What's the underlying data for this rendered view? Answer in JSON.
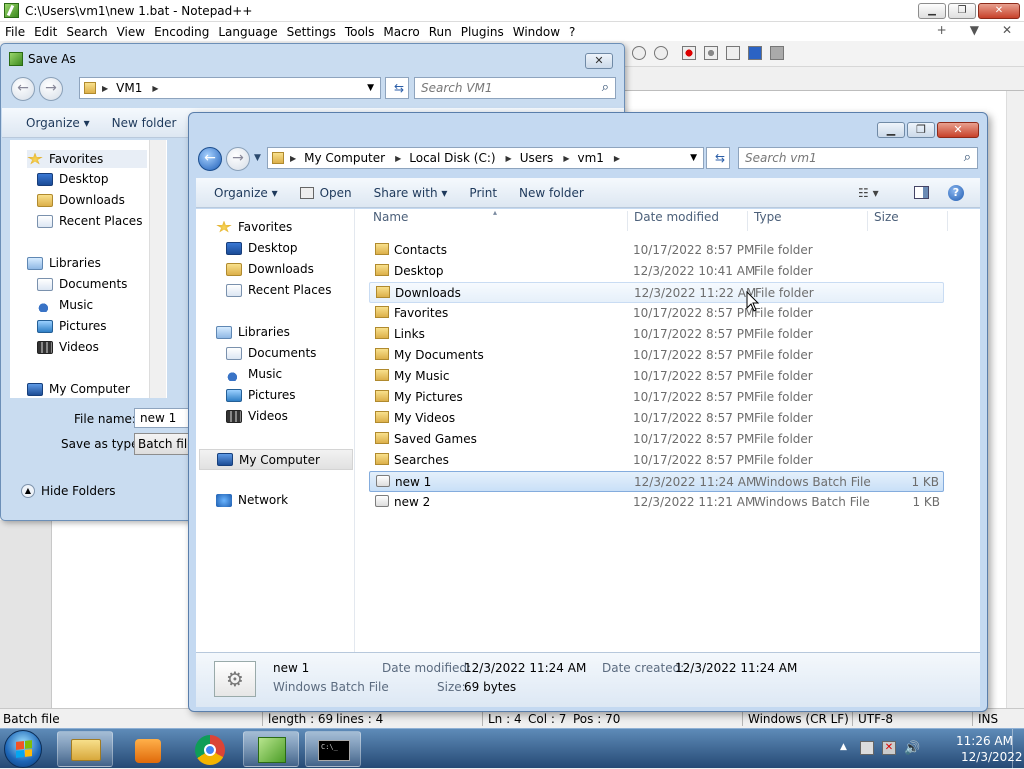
{
  "npp": {
    "title": "C:\\Users\\vm1\\new 1.bat - Notepad++",
    "menu": [
      "File",
      "Edit",
      "Search",
      "View",
      "Encoding",
      "Language",
      "Settings",
      "Tools",
      "Macro",
      "Run",
      "Plugins",
      "Window",
      "?"
    ],
    "menu_right": [
      "+",
      "▼",
      "✕"
    ],
    "window_buttons": {
      "min": "▁",
      "max": "❐",
      "close": "✕"
    },
    "status": {
      "type": "Batch file",
      "length": "length : 69",
      "lines": "lines : 4",
      "ln": "Ln : 4",
      "col": "Col : 7",
      "pos": "Pos : 70",
      "eol": "Windows (CR LF)",
      "encoding": "UTF-8",
      "mode": "INS"
    }
  },
  "saveas": {
    "title": "Save As",
    "close": "✕",
    "address": [
      "VM1"
    ],
    "search_placeholder": "Search VM1",
    "toolbar": {
      "organize": "Organize ▾",
      "new_folder": "New folder"
    },
    "nav": {
      "favorites": "Favorites",
      "desktop": "Desktop",
      "downloads": "Downloads",
      "recent": "Recent Places",
      "libraries": "Libraries",
      "documents": "Documents",
      "music": "Music",
      "pictures": "Pictures",
      "videos": "Videos",
      "computer": "My Computer"
    },
    "file_name_label": "File name:",
    "file_name_value": "new 1",
    "save_type_label": "Save as type:",
    "save_type_value": "Batch file",
    "hide_folders": "Hide Folders"
  },
  "explorer": {
    "address": [
      "My Computer",
      "Local Disk (C:)",
      "Users",
      "vm1"
    ],
    "search_placeholder": "Search vm1",
    "toolbar": {
      "organize": "Organize ▾",
      "open": "Open",
      "share": "Share with ▾",
      "print": "Print",
      "new_folder": "New folder"
    },
    "nav": {
      "favorites": "Favorites",
      "desktop": "Desktop",
      "downloads": "Downloads",
      "recent": "Recent Places",
      "libraries": "Libraries",
      "documents": "Documents",
      "music": "Music",
      "pictures": "Pictures",
      "videos": "Videos",
      "computer": "My Computer",
      "network": "Network"
    },
    "columns": {
      "name": "Name",
      "date": "Date modified",
      "type": "Type",
      "size": "Size"
    },
    "files": [
      {
        "name": "Contacts",
        "date": "10/17/2022 8:57 PM",
        "type": "File folder",
        "size": ""
      },
      {
        "name": "Desktop",
        "date": "12/3/2022 10:41 AM",
        "type": "File folder",
        "size": ""
      },
      {
        "name": "Downloads",
        "date": "12/3/2022 11:22 AM",
        "type": "File folder",
        "size": ""
      },
      {
        "name": "Favorites",
        "date": "10/17/2022 8:57 PM",
        "type": "File folder",
        "size": ""
      },
      {
        "name": "Links",
        "date": "10/17/2022 8:57 PM",
        "type": "File folder",
        "size": ""
      },
      {
        "name": "My Documents",
        "date": "10/17/2022 8:57 PM",
        "type": "File folder",
        "size": ""
      },
      {
        "name": "My Music",
        "date": "10/17/2022 8:57 PM",
        "type": "File folder",
        "size": ""
      },
      {
        "name": "My Pictures",
        "date": "10/17/2022 8:57 PM",
        "type": "File folder",
        "size": ""
      },
      {
        "name": "My Videos",
        "date": "10/17/2022 8:57 PM",
        "type": "File folder",
        "size": ""
      },
      {
        "name": "Saved Games",
        "date": "10/17/2022 8:57 PM",
        "type": "File folder",
        "size": ""
      },
      {
        "name": "Searches",
        "date": "10/17/2022 8:57 PM",
        "type": "File folder",
        "size": ""
      },
      {
        "name": "new 1",
        "date": "12/3/2022 11:24 AM",
        "type": "Windows Batch File",
        "size": "1 KB"
      },
      {
        "name": "new 2",
        "date": "12/3/2022 11:21 AM",
        "type": "Windows Batch File",
        "size": "1 KB"
      }
    ],
    "details": {
      "name": "new 1",
      "type": "Windows Batch File",
      "modified_label": "Date modified:",
      "modified_value": "12/3/2022 11:24 AM",
      "created_label": "Date created:",
      "created_value": "12/3/2022 11:24 AM",
      "size_label": "Size:",
      "size_value": "69 bytes"
    }
  },
  "taskbar": {
    "time": "11:26 AM",
    "date": "12/3/2022",
    "apps": [
      "explorer-icon",
      "media-player-icon",
      "chrome-icon",
      "notepadpp-icon",
      "cmd-icon"
    ]
  }
}
